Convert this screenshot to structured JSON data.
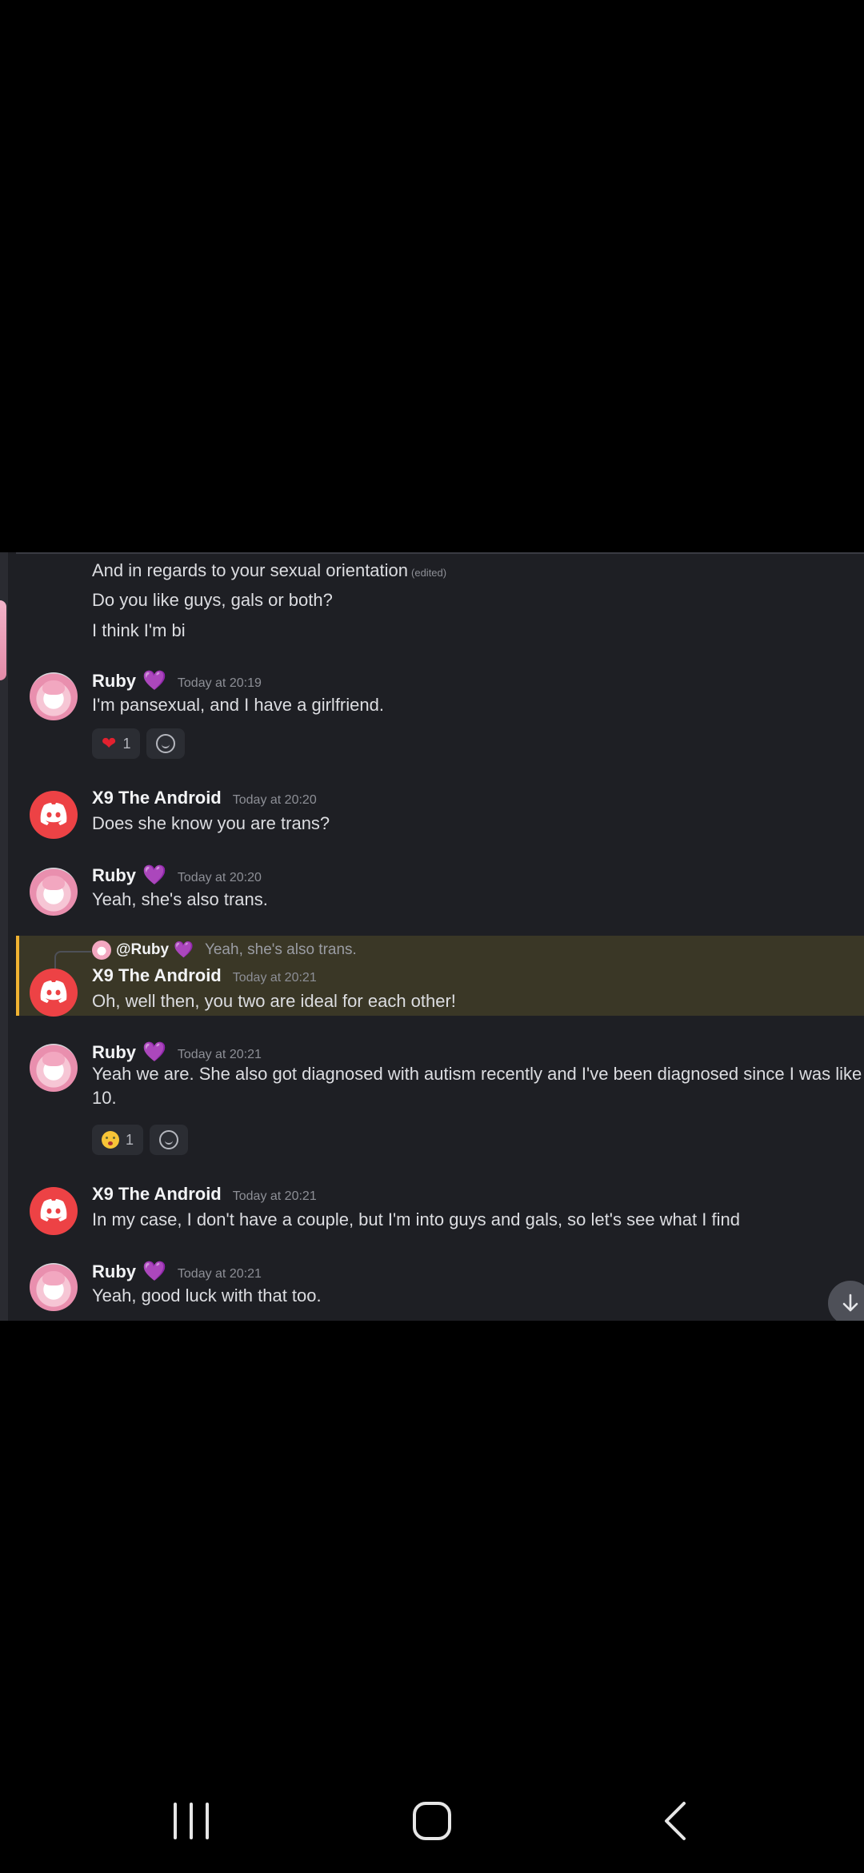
{
  "intro_lines": [
    "And in regards to your sexual orientation",
    "Do you like guys, gals or both?",
    "I think I'm bi"
  ],
  "edited_label": "(edited)",
  "messages": [
    {
      "author": "Ruby",
      "author_badge": "💜",
      "time": "Today at 20:19",
      "text": "I'm pansexual, and I have a girlfriend.",
      "reaction_count": "1"
    },
    {
      "author": "X9 The Android",
      "time": "Today at 20:20",
      "text": "Does she know you are trans?"
    },
    {
      "author": "Ruby",
      "author_badge": "💜",
      "time": "Today at 20:20",
      "text": "Yeah, she's also trans."
    },
    {
      "author": "X9 The Android",
      "time": "Today at 20:21",
      "text": "Oh, well then, you two are ideal for each other!",
      "reply_to": "@Ruby",
      "reply_quote": "Yeah, she's also trans."
    },
    {
      "author": "Ruby",
      "author_badge": "💜",
      "time": "Today at 20:21",
      "text": "Yeah we are. She also got diagnosed with autism recently and I've been diagnosed since I was like 10.",
      "reaction_count": "1"
    },
    {
      "author": "X9 The Android",
      "time": "Today at 20:21",
      "text": "In my case, I don't have a couple, but I'm into guys and gals, so let's see what I find"
    },
    {
      "author": "Ruby",
      "author_badge": "💜",
      "time": "Today at 20:21",
      "text": "Yeah, good luck with that too."
    }
  ],
  "colors": {
    "background": "#1e1f24",
    "bot_avatar": "#ed4245",
    "highlight": "#3a3726",
    "highlight_border": "#f0b232",
    "heart_purple": "#9b59ff"
  },
  "icons": {
    "scroll_down": "arrow-down-icon",
    "nav_recents": "recents-icon",
    "nav_home": "home-icon",
    "nav_back": "back-icon"
  }
}
